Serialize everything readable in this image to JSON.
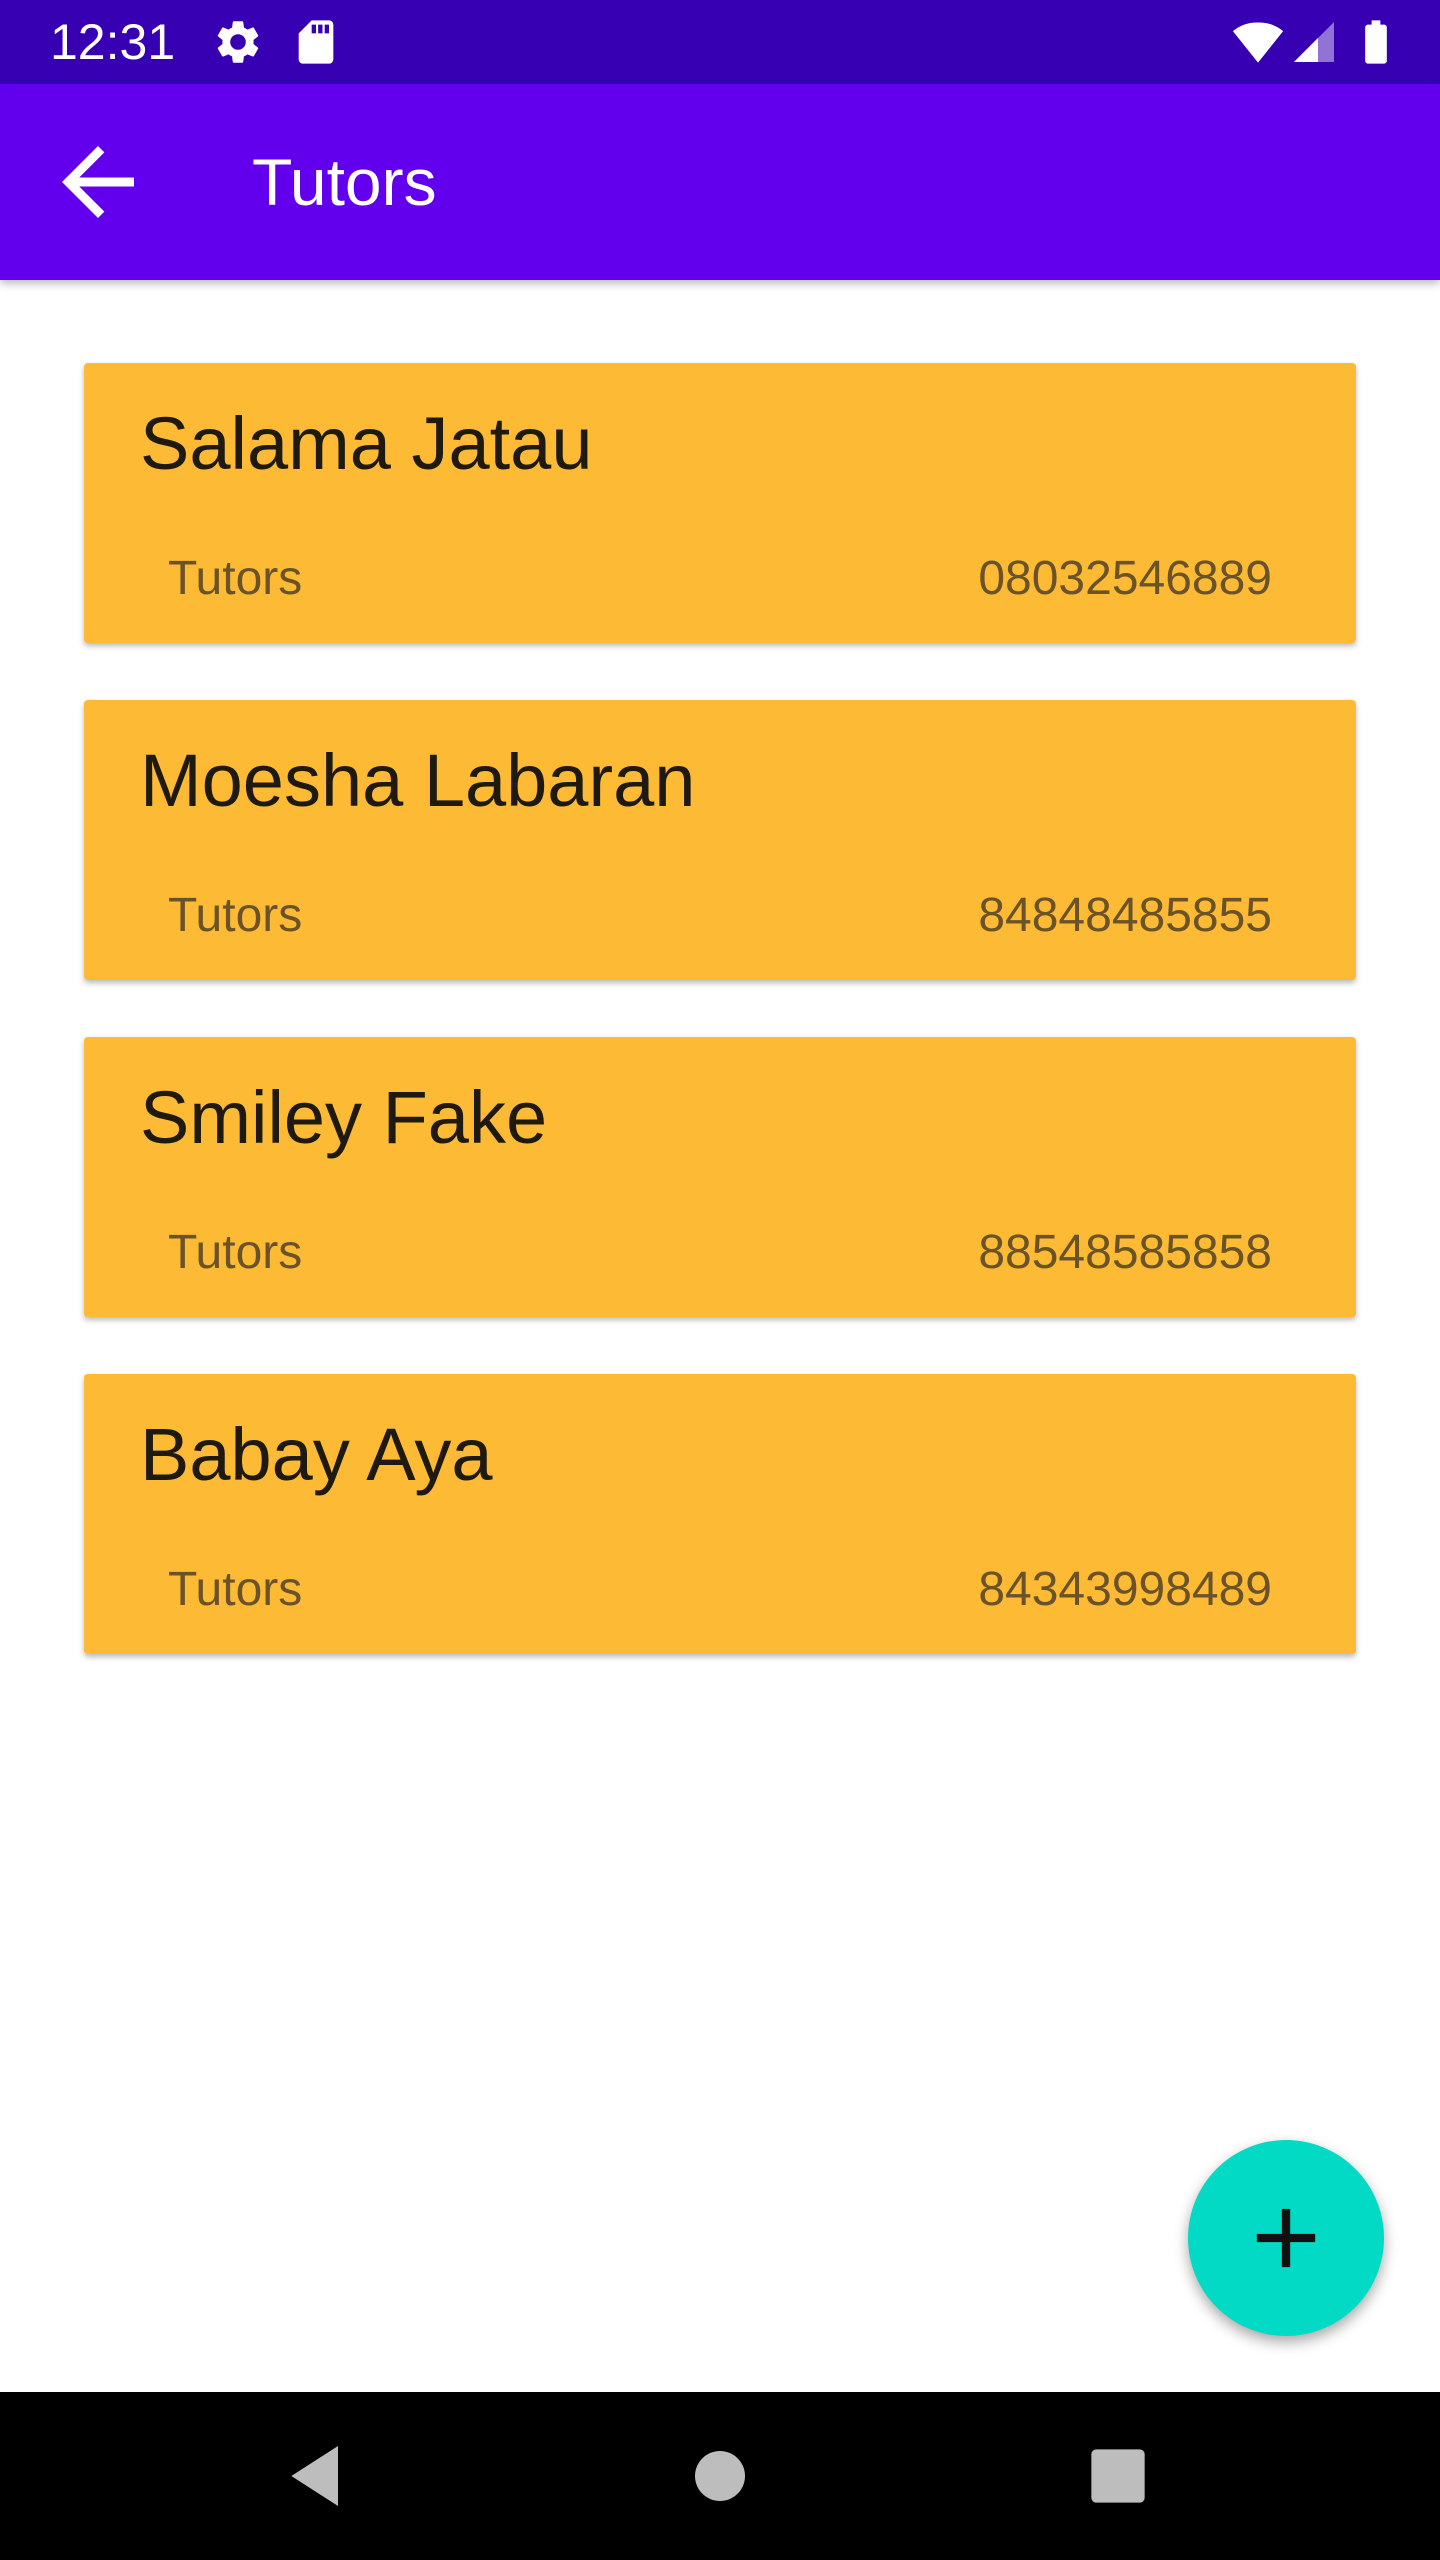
{
  "status_bar": {
    "time": "12:31",
    "icons": [
      "gear-icon",
      "sd-card-icon",
      "wifi-icon",
      "signal-icon",
      "battery-icon"
    ]
  },
  "app_bar": {
    "title": "Tutors",
    "back_icon": "arrow-back-icon"
  },
  "tutors": [
    {
      "name": "Salama Jatau",
      "category": "Tutors",
      "phone": "08032546889"
    },
    {
      "name": "Moesha Labaran",
      "category": "Tutors",
      "phone": "84848485855"
    },
    {
      "name": "Smiley Fake",
      "category": "Tutors",
      "phone": "88548585858"
    },
    {
      "name": "Babay Aya",
      "category": "Tutors",
      "phone": "84343998489"
    }
  ],
  "fab": {
    "icon": "plus-icon"
  },
  "nav_bar": {
    "icons": [
      "back-triangle-icon",
      "home-circle-icon",
      "recents-square-icon"
    ]
  },
  "colors": {
    "status_bar": "#3700b3",
    "app_bar": "#6200ee",
    "card": "#fdba35",
    "fab": "#03dac5"
  }
}
